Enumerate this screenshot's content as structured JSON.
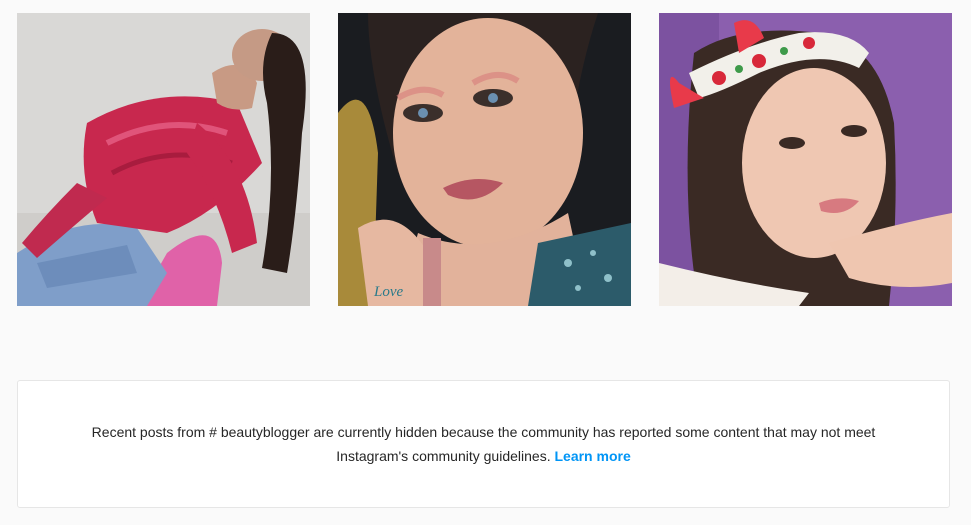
{
  "posts": [
    {
      "alt": "Woman in red textured crop top and jeans leaning back on a pink chair"
    },
    {
      "alt": "Close-up selfie of woman with pink eye makeup holding a lipstick, 'Love' tattoo on hand"
    },
    {
      "alt": "Woman with watermelon-print headband posing against a purple wall"
    }
  ],
  "notice": {
    "message": "Recent posts from # beautyblogger are currently hidden because the community has reported some content that may not meet Instagram's community guidelines.",
    "link_label": "Learn more"
  },
  "photo_text": {
    "tattoo": "Love"
  },
  "colors": {
    "link": "#0095f6",
    "text": "#262626",
    "page_bg": "#fafafa"
  }
}
